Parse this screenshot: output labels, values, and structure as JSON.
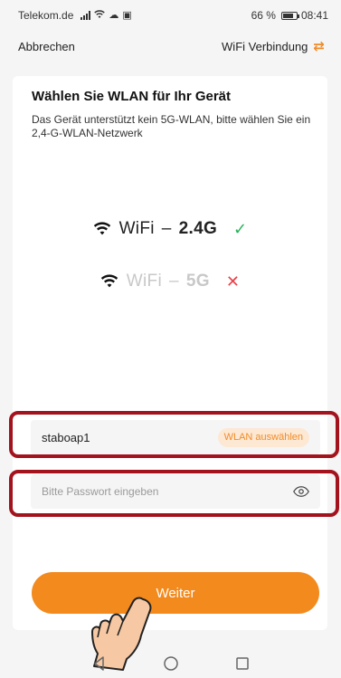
{
  "status_bar": {
    "carrier": "Telekom.de",
    "battery_percent": "66 %",
    "time": "08:41"
  },
  "nav": {
    "cancel_label": "Abbrechen",
    "mode_label": "WiFi Verbindung",
    "mode_icon": "swap-arrows-icon"
  },
  "card": {
    "title": "Wählen Sie WLAN für Ihr Gerät",
    "description": "Das Gerät unterstützt kein 5G-WLAN, bitte wählen Sie ein 2,4-G-WLAN-Netzwerk",
    "wifi_options": [
      {
        "label": "WiFi",
        "dash": "–",
        "band": "2.4G",
        "supported": true,
        "mark": "✓"
      },
      {
        "label": "WiFi",
        "dash": "–",
        "band": "5G",
        "supported": false,
        "mark": "✕"
      }
    ],
    "ssid_value": "staboap1",
    "select_wlan_label": "WLAN auswählen",
    "password_placeholder": "Bitte Passwort eingeben",
    "next_label": "Weiter"
  },
  "colors": {
    "accent": "#f28a1e",
    "ok": "#27b35a",
    "error": "#e8424a",
    "highlight": "#a3131d"
  }
}
